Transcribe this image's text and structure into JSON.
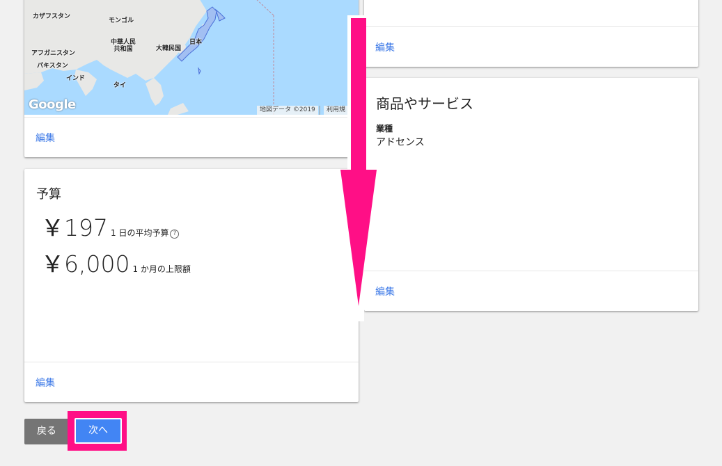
{
  "location_card": {
    "map_labels": {
      "kazakhstan": "カザフスタン",
      "mongolia": "モンゴル",
      "china": "中華人民\n共和国",
      "korea": "大韓民国",
      "japan": "日本",
      "afghanistan": "アフガニスタン",
      "pakistan": "パキスタン",
      "india": "インド",
      "thailand": "タイ"
    },
    "google_logo": "Google",
    "map_data_attribution": "地図データ ©2019",
    "terms_link": "利用規",
    "edit_label": "編集"
  },
  "budget_card": {
    "title": "予算",
    "daily_amount": "￥197",
    "daily_label": "1 日の平均予算",
    "monthly_amount": "￥6,000",
    "monthly_label": "1 か月の上限額",
    "help_icon": "question-circle-icon",
    "edit_label": "編集"
  },
  "top_right_card": {
    "edit_label": "編集"
  },
  "products_card": {
    "title": "商品やサービス",
    "field_label": "業種",
    "field_value": "アドセンス",
    "edit_label": "編集"
  },
  "buttons": {
    "back_label": "戻る",
    "next_label": "次へ"
  },
  "colors": {
    "accent_pink": "#ff0f86",
    "link_blue": "#3b78e7",
    "primary_button": "#4285f4",
    "secondary_button": "#757575",
    "map_water": "#aadaff"
  }
}
